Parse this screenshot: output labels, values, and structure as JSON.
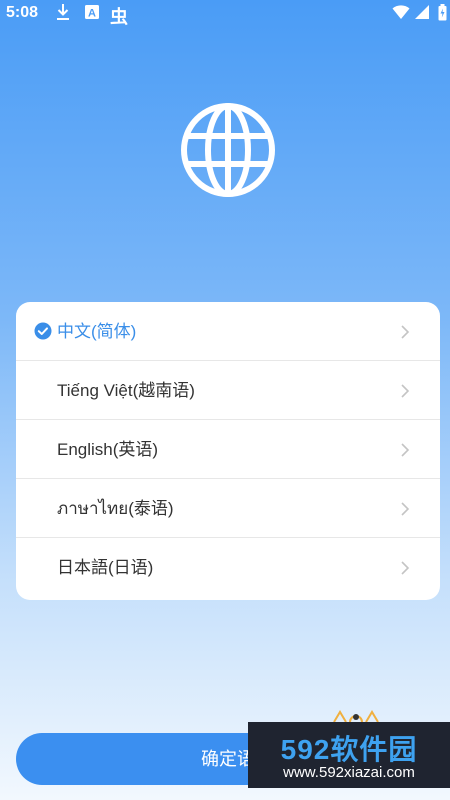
{
  "status_bar": {
    "time": "5:08",
    "icons_left": [
      "download-icon",
      "text-a-icon",
      "bug-icon"
    ],
    "bug_glyph": "虫",
    "a_glyph": "A",
    "icons_right": [
      "wifi-icon",
      "signal-icon",
      "battery-icon"
    ]
  },
  "globe": {
    "icon": "globe-icon"
  },
  "languages": [
    {
      "label": "中文(简体)",
      "selected": true
    },
    {
      "label": "Tiếng Việt(越南语)",
      "selected": false
    },
    {
      "label": "English(英语)",
      "selected": false
    },
    {
      "label": "ภาษาไทย(泰语)",
      "selected": false
    },
    {
      "label": "日本語(日语)",
      "selected": false
    }
  ],
  "confirm_button": {
    "label": "确定语"
  },
  "watermark": {
    "brand": "592软件园",
    "url": "www.592xiazai.com"
  },
  "colors": {
    "accent": "#3b8ff0",
    "selected_text": "#3a8ee8",
    "gradient_top": "#4a9cf6",
    "gradient_bottom": "#f2f8fe"
  }
}
